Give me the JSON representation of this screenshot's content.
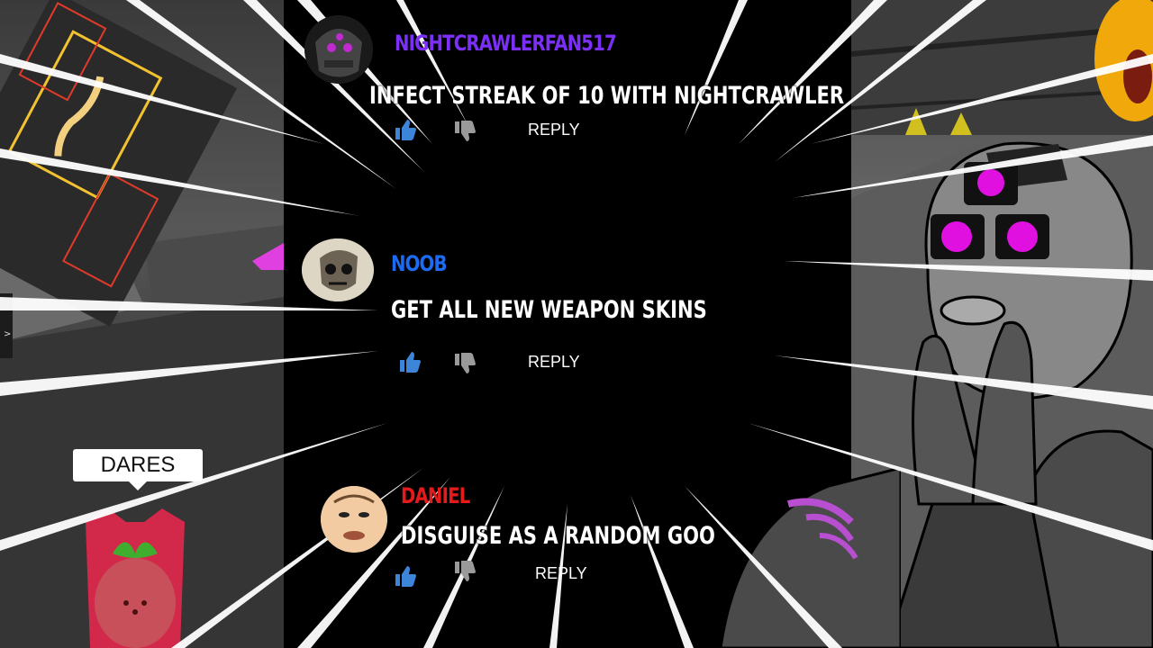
{
  "comments": [
    {
      "username": "NIGHTCRAWLERFAN517",
      "username_color": "#7b2ff7",
      "text": "INFECT STREAK OF 10 WITH NIGHTCRAWLER",
      "reply_label": "REPLY",
      "avatar_icon": "masked-robot-avatar"
    },
    {
      "username": "NOOB",
      "username_color": "#1d6bf2",
      "text": "GET ALL NEW WEAPON SKINS",
      "reply_label": "REPLY",
      "avatar_icon": "sketch-face-avatar"
    },
    {
      "username": "DANIEL",
      "username_color": "#e51b1b",
      "text": "DISGUISE AS A RANDOM GOO",
      "reply_label": "REPLY",
      "avatar_icon": "cartoon-face-avatar"
    }
  ],
  "left_scene": {
    "bubble_label": "DARES",
    "side_tab_glyph": ">"
  },
  "colors": {
    "like_blue": "#3d85d8",
    "dislike_gray": "#9a9a9a",
    "background": "#000000",
    "neon_magenta": "#e010e0"
  }
}
